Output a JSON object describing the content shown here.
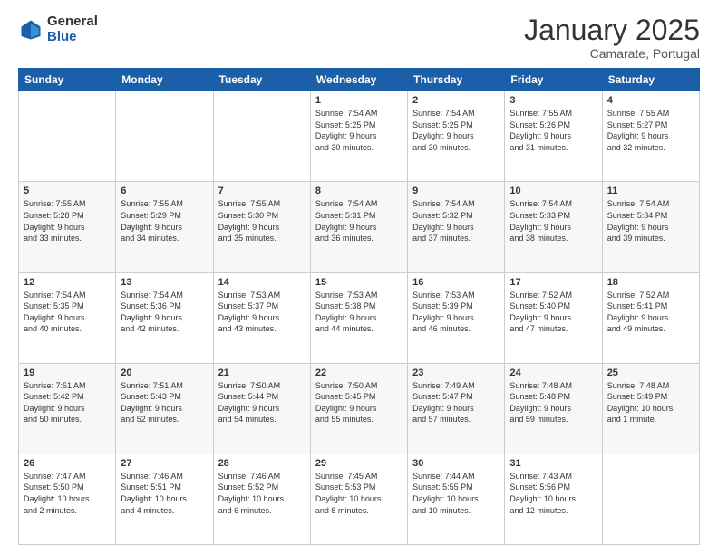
{
  "logo": {
    "general": "General",
    "blue": "Blue"
  },
  "header": {
    "month": "January 2025",
    "location": "Camarate, Portugal"
  },
  "days_of_week": [
    "Sunday",
    "Monday",
    "Tuesday",
    "Wednesday",
    "Thursday",
    "Friday",
    "Saturday"
  ],
  "weeks": [
    [
      {
        "day": "",
        "info": ""
      },
      {
        "day": "",
        "info": ""
      },
      {
        "day": "",
        "info": ""
      },
      {
        "day": "1",
        "info": "Sunrise: 7:54 AM\nSunset: 5:25 PM\nDaylight: 9 hours\nand 30 minutes."
      },
      {
        "day": "2",
        "info": "Sunrise: 7:54 AM\nSunset: 5:25 PM\nDaylight: 9 hours\nand 30 minutes."
      },
      {
        "day": "3",
        "info": "Sunrise: 7:55 AM\nSunset: 5:26 PM\nDaylight: 9 hours\nand 31 minutes."
      },
      {
        "day": "4",
        "info": "Sunrise: 7:55 AM\nSunset: 5:27 PM\nDaylight: 9 hours\nand 32 minutes."
      }
    ],
    [
      {
        "day": "5",
        "info": "Sunrise: 7:55 AM\nSunset: 5:28 PM\nDaylight: 9 hours\nand 33 minutes."
      },
      {
        "day": "6",
        "info": "Sunrise: 7:55 AM\nSunset: 5:29 PM\nDaylight: 9 hours\nand 34 minutes."
      },
      {
        "day": "7",
        "info": "Sunrise: 7:55 AM\nSunset: 5:30 PM\nDaylight: 9 hours\nand 35 minutes."
      },
      {
        "day": "8",
        "info": "Sunrise: 7:54 AM\nSunset: 5:31 PM\nDaylight: 9 hours\nand 36 minutes."
      },
      {
        "day": "9",
        "info": "Sunrise: 7:54 AM\nSunset: 5:32 PM\nDaylight: 9 hours\nand 37 minutes."
      },
      {
        "day": "10",
        "info": "Sunrise: 7:54 AM\nSunset: 5:33 PM\nDaylight: 9 hours\nand 38 minutes."
      },
      {
        "day": "11",
        "info": "Sunrise: 7:54 AM\nSunset: 5:34 PM\nDaylight: 9 hours\nand 39 minutes."
      }
    ],
    [
      {
        "day": "12",
        "info": "Sunrise: 7:54 AM\nSunset: 5:35 PM\nDaylight: 9 hours\nand 40 minutes."
      },
      {
        "day": "13",
        "info": "Sunrise: 7:54 AM\nSunset: 5:36 PM\nDaylight: 9 hours\nand 42 minutes."
      },
      {
        "day": "14",
        "info": "Sunrise: 7:53 AM\nSunset: 5:37 PM\nDaylight: 9 hours\nand 43 minutes."
      },
      {
        "day": "15",
        "info": "Sunrise: 7:53 AM\nSunset: 5:38 PM\nDaylight: 9 hours\nand 44 minutes."
      },
      {
        "day": "16",
        "info": "Sunrise: 7:53 AM\nSunset: 5:39 PM\nDaylight: 9 hours\nand 46 minutes."
      },
      {
        "day": "17",
        "info": "Sunrise: 7:52 AM\nSunset: 5:40 PM\nDaylight: 9 hours\nand 47 minutes."
      },
      {
        "day": "18",
        "info": "Sunrise: 7:52 AM\nSunset: 5:41 PM\nDaylight: 9 hours\nand 49 minutes."
      }
    ],
    [
      {
        "day": "19",
        "info": "Sunrise: 7:51 AM\nSunset: 5:42 PM\nDaylight: 9 hours\nand 50 minutes."
      },
      {
        "day": "20",
        "info": "Sunrise: 7:51 AM\nSunset: 5:43 PM\nDaylight: 9 hours\nand 52 minutes."
      },
      {
        "day": "21",
        "info": "Sunrise: 7:50 AM\nSunset: 5:44 PM\nDaylight: 9 hours\nand 54 minutes."
      },
      {
        "day": "22",
        "info": "Sunrise: 7:50 AM\nSunset: 5:45 PM\nDaylight: 9 hours\nand 55 minutes."
      },
      {
        "day": "23",
        "info": "Sunrise: 7:49 AM\nSunset: 5:47 PM\nDaylight: 9 hours\nand 57 minutes."
      },
      {
        "day": "24",
        "info": "Sunrise: 7:48 AM\nSunset: 5:48 PM\nDaylight: 9 hours\nand 59 minutes."
      },
      {
        "day": "25",
        "info": "Sunrise: 7:48 AM\nSunset: 5:49 PM\nDaylight: 10 hours\nand 1 minute."
      }
    ],
    [
      {
        "day": "26",
        "info": "Sunrise: 7:47 AM\nSunset: 5:50 PM\nDaylight: 10 hours\nand 2 minutes."
      },
      {
        "day": "27",
        "info": "Sunrise: 7:46 AM\nSunset: 5:51 PM\nDaylight: 10 hours\nand 4 minutes."
      },
      {
        "day": "28",
        "info": "Sunrise: 7:46 AM\nSunset: 5:52 PM\nDaylight: 10 hours\nand 6 minutes."
      },
      {
        "day": "29",
        "info": "Sunrise: 7:45 AM\nSunset: 5:53 PM\nDaylight: 10 hours\nand 8 minutes."
      },
      {
        "day": "30",
        "info": "Sunrise: 7:44 AM\nSunset: 5:55 PM\nDaylight: 10 hours\nand 10 minutes."
      },
      {
        "day": "31",
        "info": "Sunrise: 7:43 AM\nSunset: 5:56 PM\nDaylight: 10 hours\nand 12 minutes."
      },
      {
        "day": "",
        "info": ""
      }
    ]
  ]
}
